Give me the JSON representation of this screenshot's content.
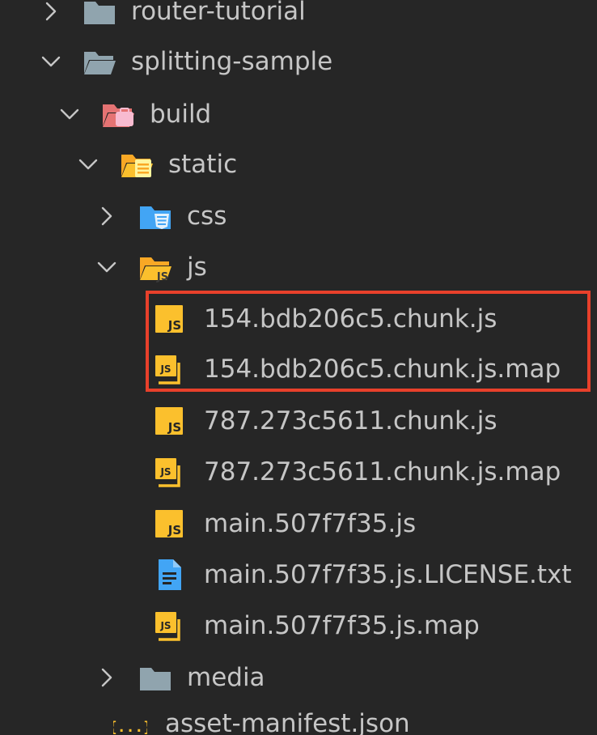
{
  "explorer": {
    "items": [
      {
        "label": "router-tutorial",
        "kind": "folder",
        "state": "collapsed",
        "icon": "folder-icon",
        "color": "#90a4ae"
      },
      {
        "label": "splitting-sample",
        "kind": "folder",
        "state": "expanded",
        "icon": "folder-open-icon",
        "color": "#90a4ae"
      },
      {
        "label": "build",
        "kind": "folder",
        "state": "expanded",
        "icon": "build-folder-icon",
        "color": "#e57373"
      },
      {
        "label": "static",
        "kind": "folder",
        "state": "expanded",
        "icon": "static-folder-icon",
        "color": "#fbc02d"
      },
      {
        "label": "css",
        "kind": "folder",
        "state": "collapsed",
        "icon": "css-folder-icon",
        "color": "#42a5f5"
      },
      {
        "label": "js",
        "kind": "folder",
        "state": "expanded",
        "icon": "js-folder-icon",
        "color": "#fbc02d"
      },
      {
        "label": "154.bdb206c5.chunk.js",
        "kind": "file",
        "icon": "js-file-icon",
        "color": "#fbc02d"
      },
      {
        "label": "154.bdb206c5.chunk.js.map",
        "kind": "file",
        "icon": "js-map-file-icon",
        "color": "#fbc02d"
      },
      {
        "label": "787.273c5611.chunk.js",
        "kind": "file",
        "icon": "js-file-icon",
        "color": "#fbc02d"
      },
      {
        "label": "787.273c5611.chunk.js.map",
        "kind": "file",
        "icon": "js-map-file-icon",
        "color": "#fbc02d"
      },
      {
        "label": "main.507f7f35.js",
        "kind": "file",
        "icon": "js-file-icon",
        "color": "#fbc02d"
      },
      {
        "label": "main.507f7f35.js.LICENSE.txt",
        "kind": "file",
        "icon": "text-file-icon",
        "color": "#42a5f5"
      },
      {
        "label": "main.507f7f35.js.map",
        "kind": "file",
        "icon": "js-map-file-icon",
        "color": "#fbc02d"
      },
      {
        "label": "media",
        "kind": "folder",
        "state": "collapsed",
        "icon": "folder-icon",
        "color": "#90a4ae"
      },
      {
        "label": "asset-manifest.json",
        "kind": "file",
        "icon": "json-file-icon",
        "color": "#fbc02d"
      }
    ],
    "js_icon_text": "JS",
    "json_icon_text": "{...}"
  },
  "highlight": {
    "color": "#e8402b",
    "items": [
      "154.bdb206c5.chunk.js",
      "154.bdb206c5.chunk.js.map"
    ]
  }
}
